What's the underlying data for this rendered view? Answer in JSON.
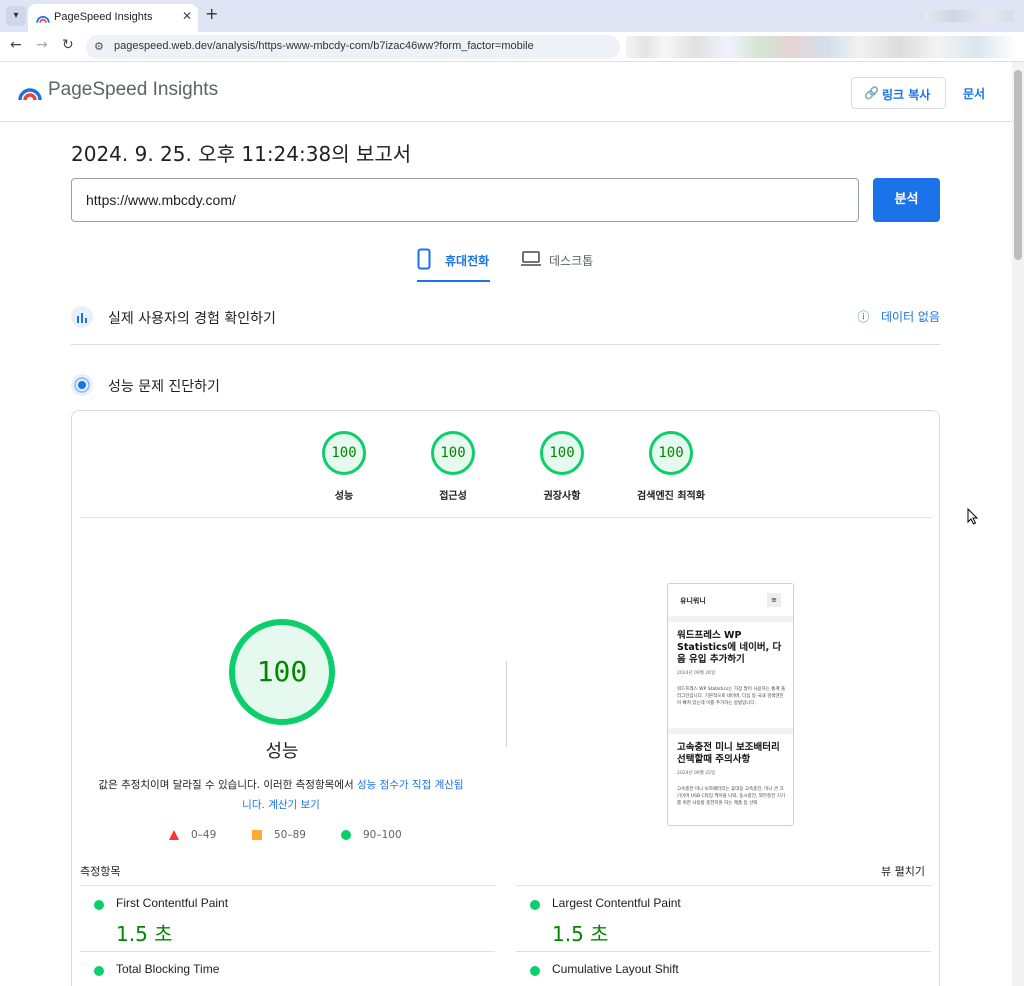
{
  "browser": {
    "tab_title": "PageSpeed Insights",
    "url": "pagespeed.web.dev/analysis/https-www-mbcdy-com/b7izac46ww?form_factor=mobile"
  },
  "header": {
    "logo_text": "PageSpeed Insights",
    "copy_link_label": "링크 복사",
    "docs_label": "문서"
  },
  "report": {
    "title": "2024. 9. 25. 오후 11:24:38의 보고서",
    "url_value": "https://www.mbcdy.com/",
    "analyze_label": "분석"
  },
  "device_tabs": {
    "mobile_label": "휴대전화",
    "desktop_label": "데스크톱"
  },
  "field_data": {
    "title": "실제 사용자의 경험 확인하기",
    "status": "데이터 없음"
  },
  "diagnose": {
    "title": "성능 문제 진단하기"
  },
  "scores": [
    {
      "label": "성능",
      "value": "100"
    },
    {
      "label": "접근성",
      "value": "100"
    },
    {
      "label": "권장사항",
      "value": "100"
    },
    {
      "label": "검색엔진 최적화",
      "value": "100"
    }
  ],
  "performance": {
    "score": "100",
    "label": "성능",
    "desc_prefix": "값은 추정치이며 달라질 수 있습니다. 이러한 측정항목에서 ",
    "desc_link": "성능 점수가 직접 계산됩니다.",
    "desc_calc_link": "계산기 보기",
    "legend": [
      {
        "range": "0–49",
        "color": "#ff3333"
      },
      {
        "range": "50–89",
        "color": "#ffaa33"
      },
      {
        "range": "90–100",
        "color": "#0cce6b"
      }
    ]
  },
  "screenshot_preview": {
    "site_name": "유니워니",
    "menu_glyph": "≡",
    "post1_title": "워드프레스 WP Statistics에 네이버, 다음 유입 추가하기",
    "post1_date": "2024년 09월 26일",
    "post1_body": "워드프레스 WP Statistics는 가장 많이 사용하는 통계 플러그인입니다. 기본적으로 네이버, 다음 등 국내 검색엔진이 빠져 있는데 이를 추가하는 방법입니다.",
    "post2_title": "고속충전 미니 보조배터리 선택할때 주의사항",
    "post2_date": "2024년 09월 25일",
    "post2_body": "고속충전 미니 보조배터리는 휴대용 고속충전, 미니 큰 크기이며 USB C타입 케이블 나와, 동시충전, 외부충전 기기를 위한 사용법 충전지원 하는 제품 등 선택"
  },
  "metrics": {
    "section_label": "측정항목",
    "expand_label": "뷰 펼치기",
    "items": [
      {
        "name": "First Contentful Paint",
        "value": "1.5 초"
      },
      {
        "name": "Largest Contentful Paint",
        "value": "1.5 초"
      },
      {
        "name": "Total Blocking Time",
        "value": ""
      },
      {
        "name": "Cumulative Layout Shift",
        "value": ""
      }
    ]
  },
  "colors": {
    "accent": "#1a73e8",
    "pass": "#0cce6b",
    "pass_text": "#008800"
  }
}
